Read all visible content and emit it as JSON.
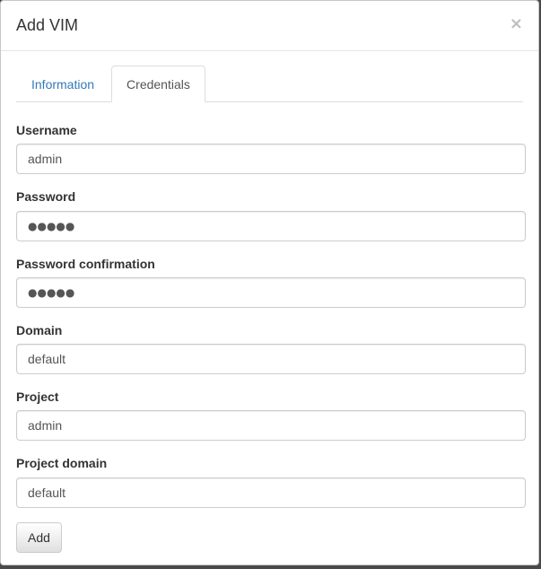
{
  "modal": {
    "title": "Add VIM",
    "close_label": "×"
  },
  "tabs": [
    {
      "label": "Information",
      "active": false
    },
    {
      "label": "Credentials",
      "active": true
    }
  ],
  "form": {
    "username": {
      "label": "Username",
      "value": "admin"
    },
    "password": {
      "label": "Password",
      "value": "●●●●●"
    },
    "password_confirmation": {
      "label": "Password confirmation",
      "value": "●●●●●"
    },
    "domain": {
      "label": "Domain",
      "value": "default"
    },
    "project": {
      "label": "Project",
      "value": "admin"
    },
    "project_domain": {
      "label": "Project domain",
      "value": "default"
    }
  },
  "actions": {
    "add_label": "Add"
  }
}
